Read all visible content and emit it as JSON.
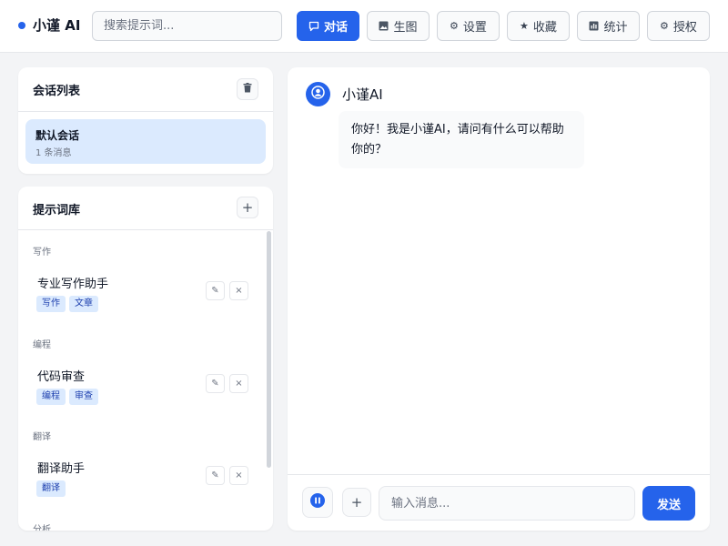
{
  "app": {
    "name": "小谨 AI",
    "accent": "#2563eb"
  },
  "search": {
    "placeholder": "搜索提示词..."
  },
  "nav": {
    "chat": {
      "label": "对话",
      "icon": "chat-bubble-icon"
    },
    "image": {
      "label": "生图",
      "icon": "image-icon"
    },
    "settings": {
      "label": "设置",
      "icon": "gear-icon"
    },
    "favorites": {
      "label": "收藏",
      "icon": "star-icon"
    },
    "stats": {
      "label": "统计",
      "icon": "bar-chart-icon"
    },
    "license": {
      "label": "授权",
      "icon": "gear-icon"
    }
  },
  "conversations": {
    "title": "会话列表",
    "items": [
      {
        "name": "默认会话",
        "count": "1 条消息"
      }
    ]
  },
  "prompts": {
    "title": "提示词库",
    "categories": [
      {
        "label": "写作",
        "items": [
          {
            "name": "专业写作助手",
            "tags": [
              "写作",
              "文章"
            ]
          }
        ]
      },
      {
        "label": "编程",
        "items": [
          {
            "name": "代码审查",
            "tags": [
              "编程",
              "审查"
            ]
          }
        ]
      },
      {
        "label": "翻译",
        "items": [
          {
            "name": "翻译助手",
            "tags": [
              "翻译"
            ]
          }
        ]
      },
      {
        "label": "分析",
        "items": []
      }
    ]
  },
  "chat": {
    "bot_name": "小谨AI",
    "messages": [
      {
        "role": "assistant",
        "text": "你好！我是小谨AI，请问有什么可以帮助你的？"
      }
    ],
    "input_placeholder": "输入消息...",
    "send_label": "发送",
    "add_label": "+"
  }
}
